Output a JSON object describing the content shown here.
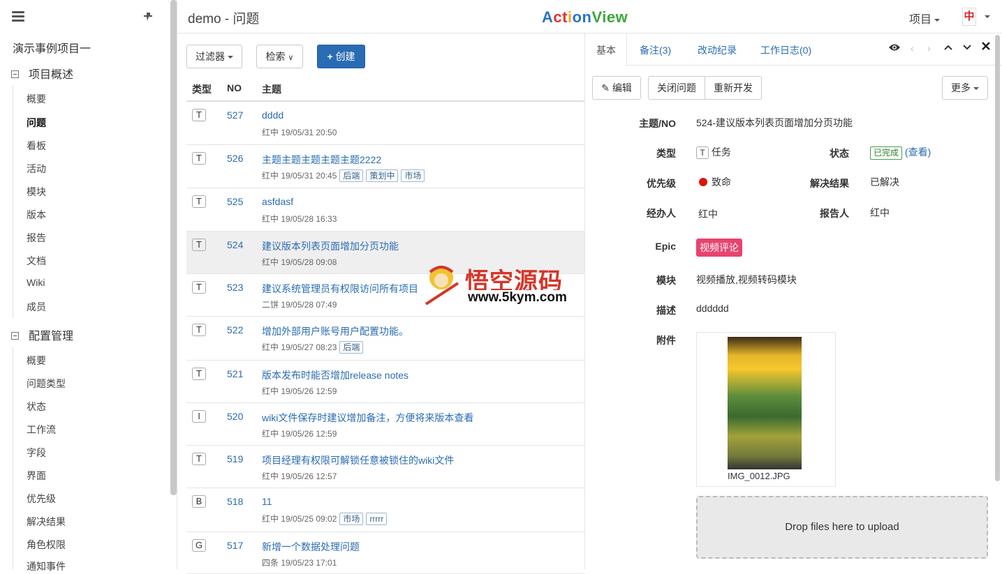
{
  "header": {
    "page_title": "demo - 问题",
    "logo_parts": [
      "A",
      "ct",
      "i",
      "on",
      "View"
    ],
    "projects_menu": "项目",
    "avatar_glyph": "中"
  },
  "sidebar": {
    "project_name": "演示事例项目一",
    "groups": [
      {
        "title": "项目概述",
        "items": [
          "概要",
          "问题",
          "看板",
          "活动",
          "模块",
          "版本",
          "报告",
          "文档",
          "Wiki",
          "成员"
        ]
      },
      {
        "title": "配置管理",
        "items": [
          "概要",
          "问题类型",
          "状态",
          "工作流",
          "字段",
          "界面",
          "优先级",
          "解决结果",
          "角色权限",
          "通知事件"
        ]
      }
    ],
    "active_item": "问题"
  },
  "toolbar": {
    "filter_label": "过滤器",
    "search_label": "检索",
    "create_label": "创建"
  },
  "table": {
    "columns": [
      "类型",
      "NO",
      "主题"
    ],
    "rows": [
      {
        "type": "T",
        "no": "527",
        "subject": "dddd",
        "meta": "红中  19/05/31 20:50",
        "labels": []
      },
      {
        "type": "T",
        "no": "526",
        "subject": "主题主题主题主题主题2222",
        "meta": "红中  19/05/31 20:45",
        "labels": [
          "后端",
          "策划中",
          "市场"
        ]
      },
      {
        "type": "T",
        "no": "525",
        "subject": "asfdasf",
        "meta": "红中  19/05/28 16:33",
        "labels": []
      },
      {
        "type": "T",
        "no": "524",
        "subject": "建议版本列表页面增加分页功能",
        "meta": "红中  19/05/28 09:08",
        "labels": [],
        "selected": true
      },
      {
        "type": "T",
        "no": "523",
        "subject": "建议系统管理员有权限访问所有项目",
        "meta": "二饼  19/05/28 07:49",
        "labels": []
      },
      {
        "type": "T",
        "no": "522",
        "subject": "增加外部用户账号用户配置功能。",
        "meta": "红中  19/05/27 08:23",
        "labels": [
          "后端"
        ]
      },
      {
        "type": "T",
        "no": "521",
        "subject": "版本发布时能否增加release notes",
        "meta": "红中  19/05/26 12:59",
        "labels": []
      },
      {
        "type": "I",
        "no": "520",
        "subject": "wiki文件保存时建议增加备注，方便将来版本查看",
        "meta": "红中  19/05/26 12:59",
        "labels": []
      },
      {
        "type": "T",
        "no": "519",
        "subject": "项目经理有权限可解锁任意被锁住的wiki文件",
        "meta": "红中  19/05/26 12:57",
        "labels": []
      },
      {
        "type": "B",
        "no": "518",
        "subject": "11",
        "meta": "红中  19/05/25 09:02",
        "labels": [
          "市场",
          "rrrrr"
        ]
      },
      {
        "type": "G",
        "no": "517",
        "subject": "新增一个数据处理问题",
        "meta": "四条  19/05/23 17:01",
        "labels": []
      }
    ]
  },
  "watermark": {
    "cn": "悟空源码",
    "url": "www.5kym.com"
  },
  "detail": {
    "tabs": [
      "基本",
      "备注(3)",
      "改动纪录",
      "工作日志(0)"
    ],
    "buttons": {
      "edit": "编辑",
      "close": "关闭问题",
      "reopen": "重新开发",
      "more": "更多"
    },
    "fields": {
      "subject_label": "主题/NO",
      "subject_value": "524-建议版本列表页面增加分页功能",
      "type_label": "类型",
      "type_icon": "T",
      "type_value": "任务",
      "status_label": "状态",
      "status_value": "已完成",
      "status_link": "(查看)",
      "priority_label": "优先级",
      "priority_value": "致命",
      "resolution_label": "解决结果",
      "resolution_value": "已解决",
      "assignee_label": "经办人",
      "assignee_value": "红中",
      "reporter_label": "报告人",
      "reporter_value": "红中",
      "epic_label": "Epic",
      "epic_value": "视频评论",
      "module_label": "模块",
      "module_value": "视频播放,视频转码模块",
      "desc_label": "描述",
      "desc_value": "dddddd",
      "attach_label": "附件",
      "attach_file": "IMG_0012.JPG"
    },
    "dropzone": "Drop files here to upload"
  },
  "colors": {
    "link": "#2a6cb3",
    "primary": "#2a6cb3",
    "epic": "#e8436e",
    "priority_dot": "#d9140c",
    "done": "#2f7d2f"
  }
}
